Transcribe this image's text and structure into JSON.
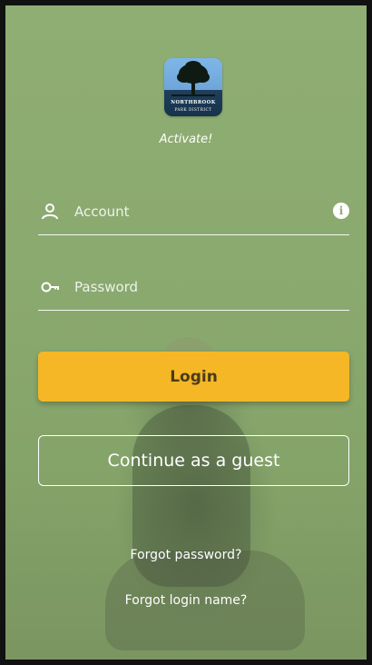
{
  "brand": {
    "logo_line1": "NORTHBROOK",
    "logo_line2": "PARK DISTRICT",
    "tagline": "Activate!"
  },
  "form": {
    "account_placeholder": "Account",
    "password_placeholder": "Password",
    "account_icon": "person-icon",
    "password_icon": "key-icon",
    "info_icon": "info-icon"
  },
  "actions": {
    "login_label": "Login",
    "guest_label": "Continue as a guest",
    "forgot_password": "Forgot password?",
    "forgot_login_name": "Forgot login name?"
  },
  "colors": {
    "background": "#8aa96f",
    "login_button": "#f5b726",
    "text": "#ffffff"
  }
}
